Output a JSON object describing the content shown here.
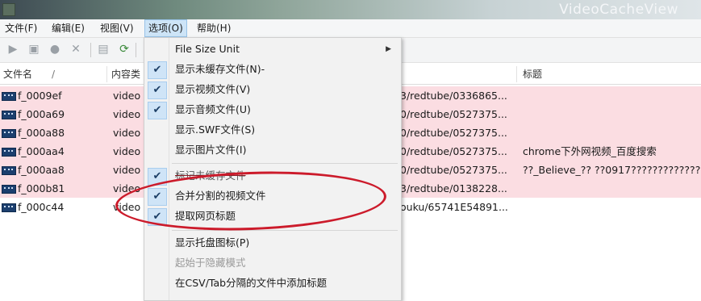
{
  "window": {
    "title": "VideoCacheView"
  },
  "menubar": {
    "items": [
      {
        "label": "文件(F)"
      },
      {
        "label": "编辑(E)"
      },
      {
        "label": "视图(V)"
      },
      {
        "label": "选项(O)",
        "active": true
      },
      {
        "label": "帮助(H)"
      }
    ]
  },
  "toolbar": {
    "buttons": [
      "play-icon",
      "copy-icon",
      "record-icon",
      "delete-icon",
      "save-icon",
      "refresh-icon"
    ]
  },
  "list": {
    "headers": {
      "filename": "文件名",
      "sort_glyph": "/",
      "content_type": "内容类",
      "title": "标题"
    },
    "rows": [
      {
        "filename": "f_0009ef",
        "content_type": "video",
        "url": "3/redtube/0336865...",
        "title": "",
        "highlight": true
      },
      {
        "filename": "f_000a69",
        "content_type": "video",
        "url": "0/redtube/0527375...",
        "title": "",
        "highlight": true
      },
      {
        "filename": "f_000a88",
        "content_type": "video",
        "url": "0/redtube/0527375...",
        "title": "",
        "highlight": true
      },
      {
        "filename": "f_000aa4",
        "content_type": "video",
        "url": "0/redtube/0527375...",
        "title": "chrome下外网视频_百度搜索",
        "highlight": true
      },
      {
        "filename": "f_000aa8",
        "content_type": "video",
        "url": "0/redtube/0527375...",
        "title": "??_Believe_?? ??0917???????????????",
        "highlight": true
      },
      {
        "filename": "f_000b81",
        "content_type": "video",
        "url": "3/redtube/0138228...",
        "title": "",
        "highlight": true
      },
      {
        "filename": "f_000c44",
        "content_type": "video",
        "url": "ouku/65741E54891...",
        "title": "",
        "highlight": false
      }
    ]
  },
  "options_menu": {
    "items": [
      {
        "label": "File Size Unit",
        "checked": false,
        "submenu": true
      },
      {
        "label": "显示未缓存文件(N)-",
        "checked": true
      },
      {
        "label": "显示视频文件(V)",
        "checked": true
      },
      {
        "label": "显示音频文件(U)",
        "checked": true
      },
      {
        "label": "显示.SWF文件(S)",
        "checked": false
      },
      {
        "label": "显示图片文件(I)",
        "checked": false
      },
      {
        "label": "标记未缓存文件",
        "checked": true
      },
      {
        "label": "合并分割的视频文件",
        "checked": true
      },
      {
        "label": "提取网页标题",
        "checked": true
      },
      {
        "label": "显示托盘图标(P)",
        "checked": false
      },
      {
        "label": "起始于隐藏模式",
        "checked": false,
        "disabled": true
      },
      {
        "label": "在CSV/Tab分隔的文件中添加标题",
        "checked": false
      }
    ],
    "check_glyph": "✔",
    "submenu_glyph": "▶"
  },
  "annotation": {
    "color": "#cc1b2b"
  }
}
